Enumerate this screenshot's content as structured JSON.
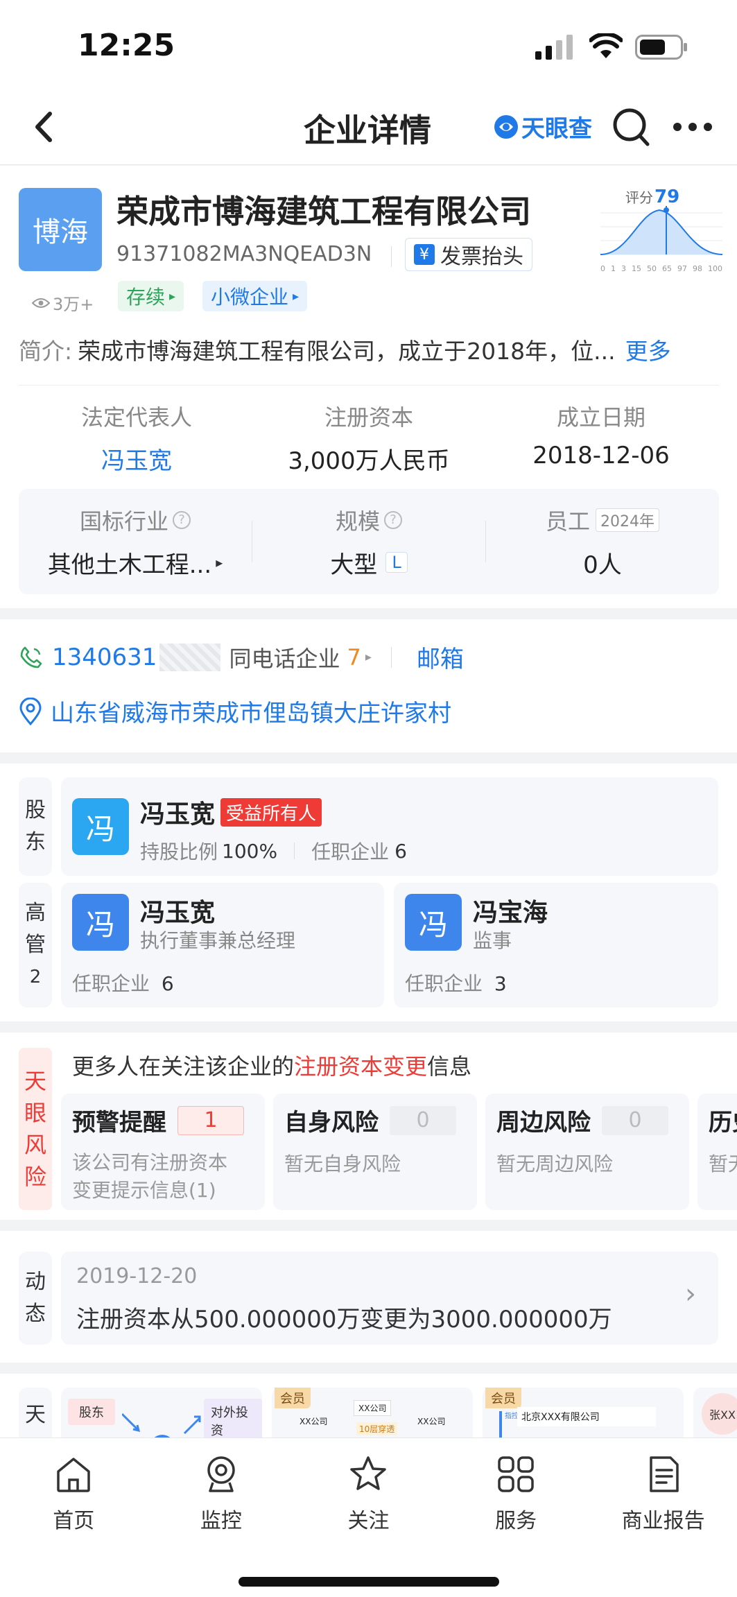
{
  "status": {
    "time": "12:25"
  },
  "nav": {
    "title": "企业详情",
    "brand": "天眼查"
  },
  "company": {
    "logo_text": "博海",
    "name": "荣成市博海建筑工程有限公司",
    "credit_code": "91371082MA3NQEAD3N",
    "invoice_label": "发票抬头",
    "views": "3万+",
    "status_tag": "存续",
    "size_tag": "小微企业",
    "score_label": "评分",
    "score_value": "79",
    "score_ticks": [
      "0",
      "1",
      "3",
      "15",
      "50",
      "65",
      "97",
      "98",
      "100"
    ],
    "intro_label": "简介:",
    "intro_text": "荣成市博海建筑工程有限公司，成立于2018年，位...",
    "intro_more": "更多"
  },
  "basic": {
    "legal_rep_label": "法定代表人",
    "legal_rep_value": "冯玉宽",
    "capital_label": "注册资本",
    "capital_value": "3,000万人民币",
    "founded_label": "成立日期",
    "founded_value": "2018-12-06",
    "industry_label": "国标行业",
    "industry_value": "其他土木工程...",
    "scale_label": "规模",
    "scale_value": "大型",
    "scale_badge": "L",
    "staff_label": "员工",
    "staff_year": "2024年",
    "staff_value": "0人"
  },
  "contact": {
    "phone": "1340631",
    "same_phone_label": "同电话企业",
    "same_phone_count": "7",
    "email_label": "邮箱",
    "address": "山东省威海市荣成市俚岛镇大庄许家村"
  },
  "shareholder": {
    "section_label": [
      "股",
      "东"
    ],
    "avatar": "冯",
    "name": "冯玉宽",
    "badge": "受益所有人",
    "ratio_label": "持股比例",
    "ratio_value": "100%",
    "jobs_label": "任职企业",
    "jobs_value": "6"
  },
  "executives": {
    "section_label": [
      "高",
      "管",
      "2"
    ],
    "list": [
      {
        "avatar": "冯",
        "name": "冯玉宽",
        "role": "执行董事兼总经理",
        "jobs_label": "任职企业",
        "jobs_value": "6"
      },
      {
        "avatar": "冯",
        "name": "冯宝海",
        "role": "监事",
        "jobs_label": "任职企业",
        "jobs_value": "3"
      }
    ]
  },
  "risk": {
    "section_label": [
      "天",
      "眼",
      "风",
      "险"
    ],
    "notice_pre": "更多人在关注该企业的",
    "notice_highlight": "注册资本变更",
    "notice_post": "信息",
    "cards": [
      {
        "title": "预警提醒",
        "count": "1",
        "desc": "该公司有注册资本",
        "desc2": "变更提示信息(1)"
      },
      {
        "title": "自身风险",
        "count": "0",
        "desc": "暂无自身风险",
        "desc2": ""
      },
      {
        "title": "周边风险",
        "count": "0",
        "desc": "暂无周边风险",
        "desc2": ""
      },
      {
        "title": "历史",
        "count": "",
        "desc": "暂无",
        "desc2": ""
      }
    ]
  },
  "dynamic": {
    "section_label": [
      "动",
      "态"
    ],
    "date": "2019-12-20",
    "text": "注册资本从500.000000万变更为3000.000000万"
  },
  "graph": {
    "section_label": "天",
    "chip_shareholder": "股东",
    "chip_invest": "对外投资",
    "member": "会员",
    "member2": "会员",
    "company_a": "XX公司",
    "company_b": "XX公司",
    "company_c": "XX公司",
    "layer": "10层穿透",
    "beijing": "北京XXX有限公司",
    "prefix_tag": "指控",
    "person": "张XX"
  },
  "tabs": [
    {
      "label": "首页",
      "icon": "home-icon"
    },
    {
      "label": "监控",
      "icon": "monitor-icon"
    },
    {
      "label": "关注",
      "icon": "star-icon"
    },
    {
      "label": "服务",
      "icon": "grid-icon"
    },
    {
      "label": "商业报告",
      "icon": "report-icon"
    }
  ]
}
